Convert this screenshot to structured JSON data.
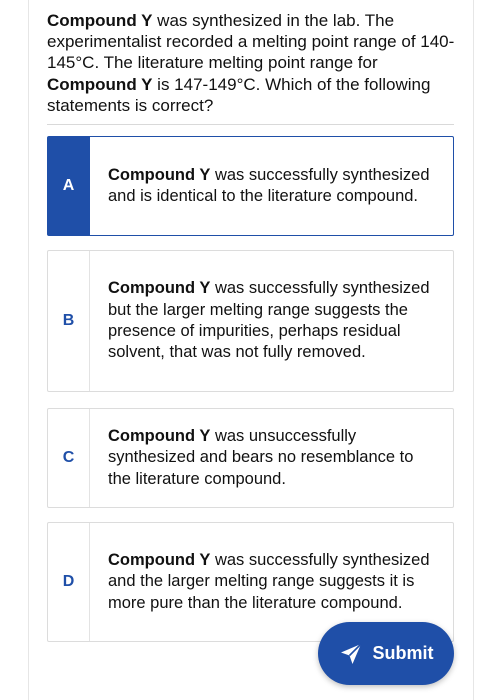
{
  "question": {
    "compound_name": "Compound Y",
    "part1": " was synthesized in the lab. The experimentalist recorded a melting point range of 140-145°C. The literature melting point range for ",
    "part2": " is 147-149°C. Which of the following statements is correct?"
  },
  "options": [
    {
      "letter": "A",
      "compound_name": "Compound Y",
      "text": " was successfully synthesized and is identical to the literature compound.",
      "selected": true
    },
    {
      "letter": "B",
      "compound_name": "Compound Y",
      "text": " was successfully synthesized but the larger melting range suggests the presence of impurities, perhaps residual solvent, that was not fully removed.",
      "selected": false
    },
    {
      "letter": "C",
      "compound_name": "Compound Y",
      "text": " was unsuccessfully synthesized and bears no resemblance to the literature compound.",
      "selected": false
    },
    {
      "letter": "D",
      "compound_name": "Compound Y",
      "text": " was successfully synthesized and the larger melting range suggests it is more pure than the literature compound.",
      "selected": false
    }
  ],
  "submit": {
    "label": "Submit",
    "icon": "send-icon"
  },
  "colors": {
    "accent": "#1f4fa8",
    "border": "#dcdcdc",
    "text": "#111111"
  }
}
